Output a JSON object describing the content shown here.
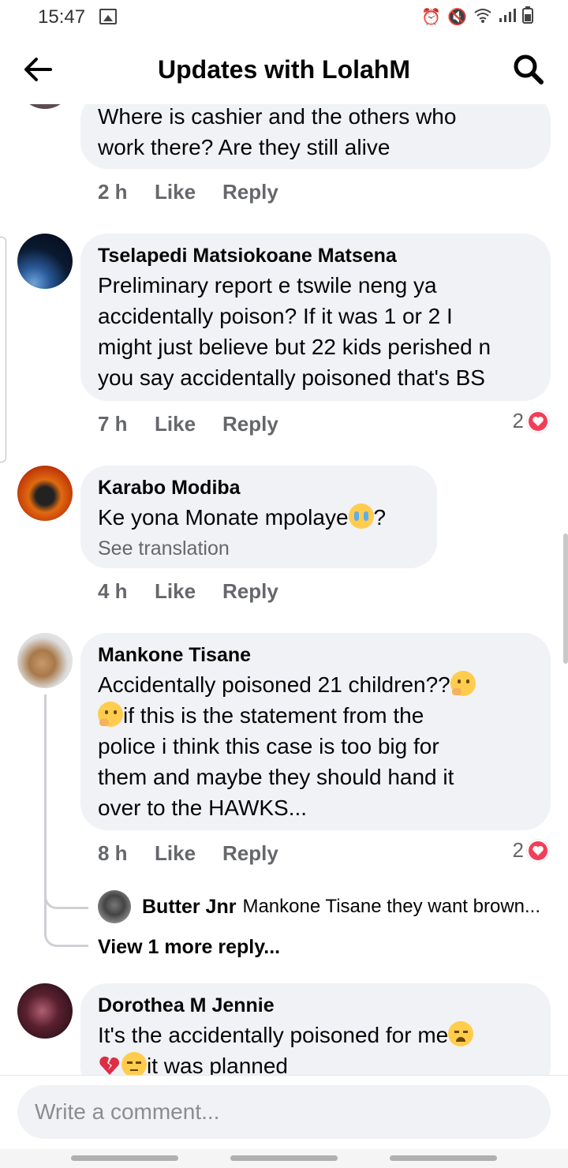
{
  "status_bar": {
    "time": "15:47",
    "icons": [
      "image-icon",
      "alarm-icon",
      "mute-icon",
      "wifi-icon",
      "signal-icon",
      "battery-icon"
    ]
  },
  "header": {
    "title": "Updates with LolahM",
    "back_icon": "arrow-left-icon",
    "search_icon": "search-icon"
  },
  "comments": [
    {
      "id": "c0",
      "author": "",
      "text_lines": [
        "Where is cashier and the others who",
        "work there? Are they still alive"
      ],
      "time": "2 h",
      "like_label": "Like",
      "reply_label": "Reply"
    },
    {
      "id": "c1",
      "author": "Tselapedi Matsiokoane Matsena",
      "text_lines": [
        "Preliminary report e tswile neng ya",
        "accidentally poison? If it was 1 or 2 I",
        "might just believe but 22 kids perished n",
        "you say accidentally poisoned that's BS"
      ],
      "time": "7 h",
      "like_label": "Like",
      "reply_label": "Reply",
      "reaction_count": "2"
    },
    {
      "id": "c2",
      "author": "Karabo Modiba",
      "text_before_emoji": "Ke yona Monate mpolaye",
      "text_after_emoji": "?",
      "see_translation": "See translation",
      "time": "4 h",
      "like_label": "Like",
      "reply_label": "Reply"
    },
    {
      "id": "c3",
      "author": "Mankone Tisane",
      "line1": "Accidentally poisoned 21 children??",
      "line2": "if this is the statement from the",
      "line3": "police i think this case is too big for",
      "line4": "them and maybe they should hand it",
      "line5": "over to the HAWKS...",
      "time": "8 h",
      "like_label": "Like",
      "reply_label": "Reply",
      "reaction_count": "2",
      "reply_preview": {
        "author": "Butter Jnr",
        "text": "Mankone Tisane they want brown..."
      },
      "view_more": "View 1 more reply..."
    },
    {
      "id": "c4",
      "author": "Dorothea M Jennie",
      "line1": "It's the accidentally poisoned for me",
      "line2": "it was planned"
    }
  ],
  "composer": {
    "placeholder": "Write a comment..."
  },
  "colors": {
    "bubble": "#f0f2f5",
    "secondary_text": "#65676b",
    "heart": "#f33e58"
  }
}
